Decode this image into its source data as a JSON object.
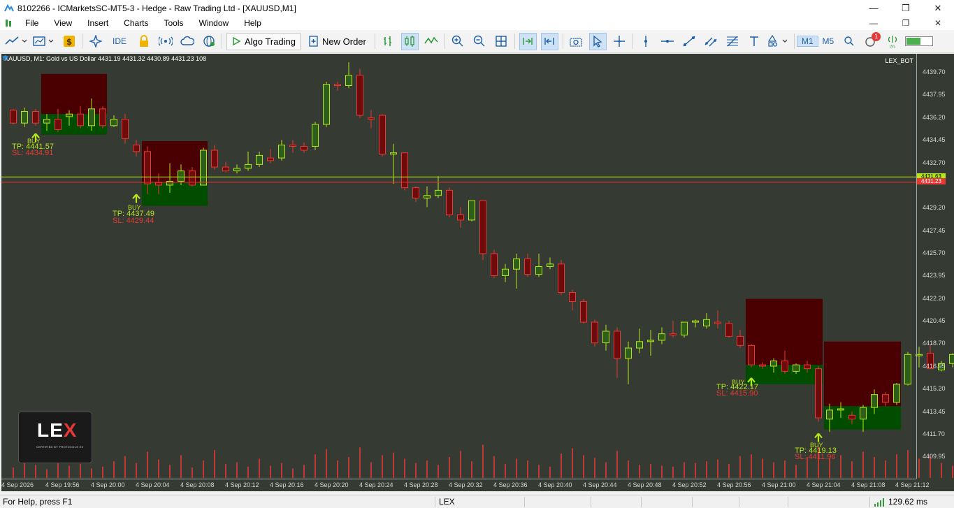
{
  "window": {
    "title": "8102266 - ICMarketsSC-MT5-3 - Hedge - Raw Trading Ltd - [XAUUSD,M1]",
    "controls": [
      "—",
      "❐",
      "✕"
    ]
  },
  "menu": {
    "items": [
      "File",
      "View",
      "Insert",
      "Charts",
      "Tools",
      "Window",
      "Help"
    ]
  },
  "toolbar": {
    "ide_label": "IDE",
    "algo_trading_label": "Algo Trading",
    "new_order_label": "New Order",
    "timeframes": [
      "M1",
      "M5"
    ],
    "active_timeframe": "M1",
    "notification_count": "1"
  },
  "chart": {
    "symbol_header": "XAUUSD, M1:  Gold vs US Dollar  4431.19 4431.32 4430.89 4431.23  108",
    "bot_label": "LEX_BOT",
    "price_labels": [
      "4439.70",
      "4437.95",
      "4436.20",
      "4434.45",
      "4432.70",
      "4429.20",
      "4427.45",
      "4425.70",
      "4423.95",
      "4422.20",
      "4420.45",
      "4418.70",
      "4416.95",
      "4415.20",
      "4413.45",
      "4411.70",
      "4409.95"
    ],
    "ask_tag": "4431.63",
    "bid_tag": "4431.23",
    "time_labels": [
      "4 Sep 2026",
      "4 Sep 19:56",
      "4 Sep 20:00",
      "4 Sep 20:04",
      "4 Sep 20:08",
      "4 Sep 20:12",
      "4 Sep 20:16",
      "4 Sep 20:20",
      "4 Sep 20:24",
      "4 Sep 20:28",
      "4 Sep 20:32",
      "4 Sep 20:36",
      "4 Sep 20:40",
      "4 Sep 20:44",
      "4 Sep 20:48",
      "4 Sep 20:52",
      "4 Sep 20:56",
      "4 Sep 21:00",
      "4 Sep 21:04",
      "4 Sep 21:08",
      "4 Sep 21:12"
    ],
    "signals": [
      {
        "label": "BUY",
        "tp": "TP: 4441.57",
        "sl": "SL: 4434.91"
      },
      {
        "label": "BUY",
        "tp": "TP: 4437.49",
        "sl": "SL: 4429.44"
      },
      {
        "label": "BUY",
        "tp": "TP: 4422.17",
        "sl": "SL: 4415.90"
      },
      {
        "label": "BUY",
        "tp": "TP: 4419.13",
        "sl": "SL: 4411.96"
      }
    ],
    "logo": {
      "text_main": "LE",
      "text_x": "X",
      "subtitle": "CERTIFIED BY PROTOCOLS EX"
    },
    "colors": {
      "background": "#353a33",
      "bull": "#b5e61d",
      "bear": "#e53935",
      "bull_body": "#2e5e1c",
      "bear_body": "#6b0d0d",
      "tp_zone": "#4a0000",
      "sl_zone": "#004d00"
    },
    "candles": [
      [
        4436.8,
        4436.9,
        4435.7,
        4435.8
      ],
      [
        4435.8,
        4437.0,
        4435.5,
        4436.7
      ],
      [
        4436.7,
        4436.9,
        4435.6,
        4435.8
      ],
      [
        4435.8,
        4436.5,
        4435.2,
        4436.1
      ],
      [
        4436.1,
        4436.9,
        4435.1,
        4435.3
      ],
      [
        4436.3,
        4436.8,
        4435.6,
        4436.5
      ],
      [
        4436.5,
        4437.1,
        4435.4,
        4435.6
      ],
      [
        4435.6,
        4437.7,
        4435.2,
        4436.9
      ],
      [
        4436.9,
        4437.1,
        4435.4,
        4435.6
      ],
      [
        4435.6,
        4436.4,
        4435.5,
        4436.1
      ],
      [
        4436.1,
        4436.5,
        4434.2,
        4434.6
      ],
      [
        4434.1,
        4434.5,
        4433.2,
        4433.6
      ],
      [
        4433.6,
        4434.0,
        4430.3,
        4431.1
      ],
      [
        4431.2,
        4431.9,
        4430.3,
        4431.0
      ],
      [
        4431.0,
        4432.7,
        4430.4,
        4431.3
      ],
      [
        4431.3,
        4432.6,
        4431.0,
        4432.1
      ],
      [
        4432.1,
        4432.4,
        4430.9,
        4431.0
      ],
      [
        4431.0,
        4433.9,
        4431.0,
        4433.7
      ],
      [
        4433.7,
        4434.1,
        4432.2,
        4432.4
      ],
      [
        4432.4,
        4432.8,
        4432.0,
        4432.1
      ],
      [
        4432.1,
        4432.6,
        4431.9,
        4432.3
      ],
      [
        4432.3,
        4433.6,
        4432.1,
        4432.6
      ],
      [
        4432.6,
        4433.6,
        4432.4,
        4433.3
      ],
      [
        4433.1,
        4433.8,
        4432.7,
        4432.9
      ],
      [
        4433.1,
        4434.5,
        4432.9,
        4434.1
      ],
      [
        4434.1,
        4434.5,
        4433.5,
        4434.0
      ],
      [
        4434.0,
        4434.3,
        4433.5,
        4433.7
      ],
      [
        4434.0,
        4435.9,
        4433.7,
        4435.7
      ],
      [
        4435.7,
        4439.0,
        4435.5,
        4438.8
      ],
      [
        4438.8,
        4439.0,
        4438.3,
        4438.7
      ],
      [
        4438.7,
        4440.5,
        4438.5,
        4439.5
      ],
      [
        4439.5,
        4440.0,
        4436.2,
        4436.4
      ],
      [
        4436.2,
        4436.8,
        4435.4,
        4436.1
      ],
      [
        4436.4,
        4436.5,
        4433.2,
        4433.4
      ],
      [
        4433.4,
        4434.2,
        4431.1,
        4433.5
      ],
      [
        4433.5,
        4433.5,
        4430.6,
        4430.8
      ],
      [
        4430.8,
        4430.9,
        4429.7,
        4430.0
      ],
      [
        4430.0,
        4430.9,
        4429.3,
        4430.2
      ],
      [
        4430.2,
        4431.7,
        4430.0,
        4430.6
      ],
      [
        4430.6,
        4430.8,
        4428.5,
        4428.7
      ],
      [
        4428.7,
        4429.3,
        4427.7,
        4428.3
      ],
      [
        4428.3,
        4429.8,
        4428.2,
        4429.8
      ],
      [
        4429.8,
        4429.8,
        4425.2,
        4425.7
      ],
      [
        4425.7,
        4426.0,
        4423.8,
        4424.0
      ],
      [
        4424.0,
        4424.9,
        4423.5,
        4424.5
      ],
      [
        4424.5,
        4425.7,
        4423.0,
        4425.3
      ],
      [
        4425.3,
        4425.7,
        4423.9,
        4424.1
      ],
      [
        4424.1,
        4425.7,
        4423.9,
        4424.7
      ],
      [
        4424.7,
        4425.4,
        4424.5,
        4424.9
      ],
      [
        4424.9,
        4425.2,
        4422.5,
        4422.7
      ],
      [
        4422.7,
        4422.9,
        4421.3,
        4422.0
      ],
      [
        4422.0,
        4422.2,
        4420.3,
        4420.4
      ],
      [
        4420.4,
        4420.6,
        4418.5,
        4418.8
      ],
      [
        4418.8,
        4420.2,
        4418.2,
        4419.7
      ],
      [
        4419.7,
        4420.0,
        4416.1,
        4417.6
      ],
      [
        4417.6,
        4418.9,
        4415.6,
        4418.4
      ],
      [
        4418.4,
        4419.9,
        4418.0,
        4418.9
      ],
      [
        4418.9,
        4419.8,
        4417.8,
        4419.0
      ],
      [
        4419.0,
        4420.0,
        4418.7,
        4419.5
      ],
      [
        4419.5,
        4420.5,
        4419.2,
        4419.4
      ],
      [
        4419.4,
        4420.4,
        4419.2,
        4420.4
      ],
      [
        4420.4,
        4420.6,
        4420.0,
        4420.5
      ],
      [
        4420.1,
        4421.1,
        4419.9,
        4420.6
      ],
      [
        4420.4,
        4421.3,
        4419.9,
        4420.3
      ],
      [
        4420.3,
        4420.5,
        4419.2,
        4419.3
      ],
      [
        4419.3,
        4419.8,
        4418.4,
        4418.6
      ],
      [
        4418.6,
        4418.7,
        4416.9,
        4417.1
      ],
      [
        4417.1,
        4417.3,
        4416.8,
        4417.0
      ],
      [
        4417.0,
        4417.6,
        4416.5,
        4417.4
      ],
      [
        4417.4,
        4418.2,
        4416.4,
        4416.6
      ],
      [
        4416.6,
        4417.2,
        4416.4,
        4417.1
      ],
      [
        4417.1,
        4417.4,
        4416.5,
        4416.8
      ],
      [
        4416.8,
        4417.0,
        4412.7,
        4413.0
      ],
      [
        4412.9,
        4414.1,
        4411.9,
        4413.6
      ],
      [
        4413.6,
        4414.2,
        4413.0,
        4413.7
      ],
      [
        4413.2,
        4413.5,
        4412.5,
        4412.9
      ],
      [
        4412.9,
        4414.0,
        4411.9,
        4413.8
      ],
      [
        4413.8,
        4415.2,
        4413.3,
        4414.8
      ],
      [
        4414.8,
        4415.0,
        4413.9,
        4414.2
      ],
      [
        4414.2,
        4415.7,
        4414.0,
        4415.6
      ],
      [
        4415.6,
        4418.1,
        4415.5,
        4417.9
      ],
      [
        4417.8,
        4418.5,
        4416.9,
        4417.9
      ],
      [
        4418.0,
        4418.7,
        4416.8,
        4416.8
      ],
      [
        4416.7,
        4417.4,
        4416.6,
        4417.2
      ],
      [
        4417.2,
        4418.0,
        4416.9,
        4417.9
      ]
    ],
    "volumes": [
      12,
      18,
      15,
      10,
      22,
      14,
      16,
      11,
      13,
      19,
      25,
      17,
      30,
      21,
      15,
      26,
      12,
      20,
      32,
      16,
      18,
      13,
      22,
      14,
      17,
      11,
      15,
      27,
      33,
      20,
      24,
      35,
      18,
      26,
      29,
      22,
      17,
      20,
      15,
      24,
      31,
      19,
      38,
      25,
      16,
      22,
      20,
      15,
      13,
      28,
      34,
      26,
      23,
      18,
      31,
      20,
      15,
      16,
      14,
      13,
      18,
      17,
      19,
      21,
      16,
      25,
      27,
      22,
      18,
      20,
      15,
      24,
      36,
      22,
      26,
      19,
      30,
      24,
      20,
      27,
      32,
      22,
      26,
      17,
      14
    ]
  },
  "statusbar": {
    "help": "For Help, press F1",
    "profile": "LEX",
    "ping": "129.62 ms"
  }
}
